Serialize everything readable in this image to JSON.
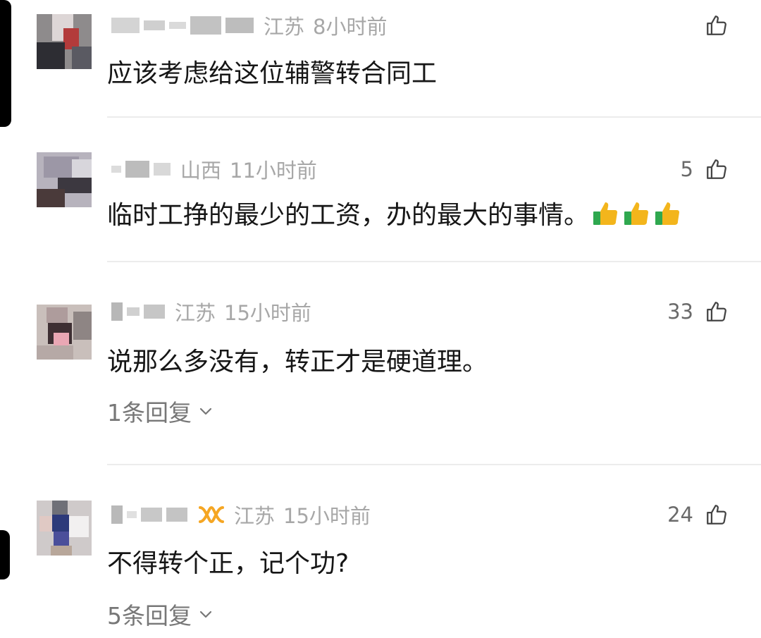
{
  "comments": [
    {
      "location": "江苏",
      "time": "8小时前",
      "likes": "",
      "text": "应该考虑给这位辅警转合同工",
      "replies": ""
    },
    {
      "location": "山西",
      "time": "11小时前",
      "likes": "5",
      "text": "临时工挣的最少的工资，办的最大的事情。",
      "replies": ""
    },
    {
      "location": "江苏",
      "time": "15小时前",
      "likes": "33",
      "text": "说那么多没有，转正才是硬道理。",
      "replies": "1条回复"
    },
    {
      "location": "江苏",
      "time": "15小时前",
      "likes": "24",
      "text": "不得转个正，记个功?",
      "replies": "5条回复"
    }
  ],
  "icons": {
    "like": "thumbs-up-outline-icon",
    "emoji": "thumbs-up-emoji-icon",
    "expand": "chevron-down-icon",
    "badge": "vip-badge-icon"
  },
  "colors": {
    "meta": "#a7a7a7",
    "text": "#161616",
    "divider": "#ececec",
    "emoji_yellow": "#f3b51c",
    "emoji_green": "#2fa84f",
    "badge_orange": "#f5a623"
  }
}
